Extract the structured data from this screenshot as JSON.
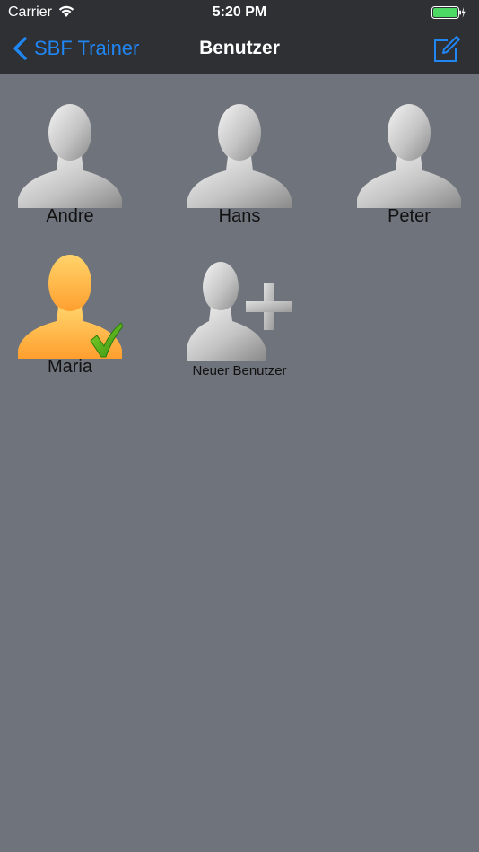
{
  "status_bar": {
    "carrier": "Carrier",
    "time": "5:20 PM",
    "wifi_icon": "wifi-icon",
    "battery_icon": "battery-charging-icon"
  },
  "nav": {
    "back_label": "SBF Trainer",
    "title": "Benutzer",
    "edit_icon": "compose-icon"
  },
  "users": [
    {
      "name": "Andre",
      "selected": false
    },
    {
      "name": "Hans",
      "selected": false
    },
    {
      "name": "Peter",
      "selected": false
    },
    {
      "name": "Maria",
      "selected": true
    }
  ],
  "new_user": {
    "label": "Neuer Benutzer"
  },
  "colors": {
    "nav_bg": "#2f3033",
    "content_bg": "#6f737b",
    "accent": "#1f86f4",
    "selected_avatar": "#ffb844",
    "checkmark": "#4caf1a",
    "battery_fill": "#4cd964"
  }
}
